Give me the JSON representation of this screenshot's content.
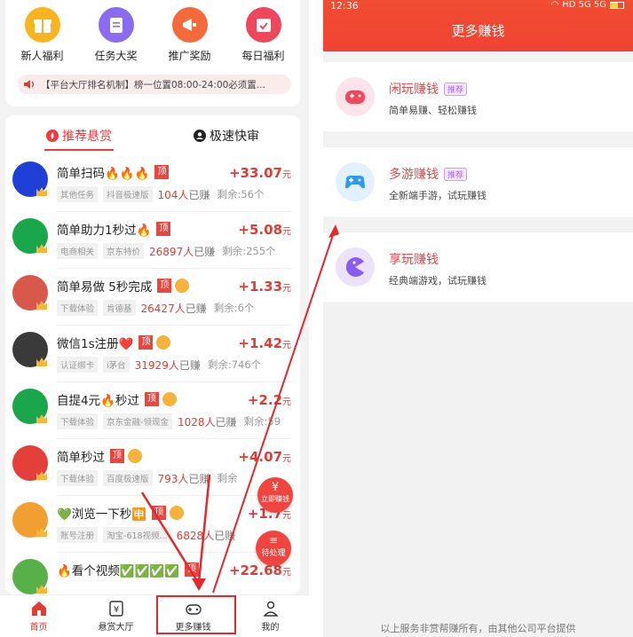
{
  "left": {
    "quick_icons": [
      {
        "label": "新人福利",
        "icon": "gift-icon",
        "color": "#f9b41e"
      },
      {
        "label": "任务大奖",
        "icon": "clipboard-icon",
        "color": "#8b6cf0"
      },
      {
        "label": "推广奖励",
        "icon": "megaphone-icon",
        "color": "#f56a3b"
      },
      {
        "label": "每日福利",
        "icon": "calendar-check-icon",
        "color": "#f0465a"
      }
    ],
    "notice": "【平台大厅排名机制】榜一位置08:00-24:00必须置...",
    "tabs": [
      {
        "label": "推荐悬赏",
        "icon": "flame-icon"
      },
      {
        "label": "极速快审",
        "icon": "user-circle-icon"
      }
    ],
    "tasks": [
      {
        "title": "简单扫码🔥🔥🔥",
        "chips": [
          "其他任务",
          "抖音极速版"
        ],
        "earned": "104人",
        "earned_suffix": "已赚",
        "remain": "剩余:56个",
        "amount": "+33.07",
        "unit": "元",
        "badge": false
      },
      {
        "title": "简单助力1秒过🔥",
        "chips": [
          "电商相关",
          "京东特价"
        ],
        "earned": "26897人",
        "earned_suffix": "已赚",
        "remain": "剩余:255个",
        "amount": "+5.08",
        "unit": "元",
        "badge": false
      },
      {
        "title": "简单易做  5秒完成",
        "chips": [
          "下载体验",
          "肯德基"
        ],
        "earned": "26427人",
        "earned_suffix": "已赚",
        "remain": "剩余:6个",
        "amount": "+1.33",
        "unit": "元",
        "badge": true
      },
      {
        "title": "微信1s注册❤️",
        "chips": [
          "认证绑卡",
          "i茅台"
        ],
        "earned": "31929人",
        "earned_suffix": "已赚",
        "remain": "剩余:746个",
        "amount": "+1.42",
        "unit": "元",
        "badge": true
      },
      {
        "title": "自提4元🔥秒过",
        "chips": [
          "下载体验",
          "京东金融-领现金"
        ],
        "earned": "1028人",
        "earned_suffix": "已赚",
        "remain": "剩余:59",
        "amount": "+2.2",
        "unit": "元",
        "badge": true
      },
      {
        "title": "简单秒过",
        "chips": [
          "下载体验",
          "百度极速版"
        ],
        "earned": "793人",
        "earned_suffix": "已赚",
        "remain": "剩余",
        "amount": "+4.07",
        "unit": "元",
        "badge": true
      },
      {
        "title": "💚浏览一下秒🈸",
        "chips": [
          "账号注册",
          "淘宝-618视频..."
        ],
        "earned": "6828人",
        "earned_suffix": "已赚",
        "remain": "",
        "amount": "+1.7",
        "unit": "元",
        "badge": true
      },
      {
        "title": "🔥看个视频✅✅✅✅",
        "chips": [],
        "earned": "",
        "earned_suffix": "",
        "remain": "",
        "amount": "+22.68",
        "unit": "元",
        "badge": false
      }
    ],
    "floats": {
      "earn_now": "立即赚钱",
      "pending": "待处理"
    },
    "tabbar": [
      {
        "label": "首页",
        "icon": "home-icon"
      },
      {
        "label": "悬赏大厅",
        "icon": "yen-board-icon"
      },
      {
        "label": "更多赚钱",
        "icon": "gamepad-icon"
      },
      {
        "label": "我的",
        "icon": "person-icon"
      }
    ]
  },
  "right": {
    "status_time": "12:36",
    "status_icons": "HD 5G 5G",
    "title": "更多赚钱",
    "games": [
      {
        "name": "闲玩赚钱",
        "tag": "推荐",
        "desc": "简单易赚、轻松赚钱",
        "icon": "gamepad-red-icon",
        "bg": "#fde4ea"
      },
      {
        "name": "多游赚钱",
        "tag": "推荐",
        "desc": "全新端手游，试玩赚钱",
        "icon": "gamepad-blue-icon",
        "bg": "#e2f1fd"
      },
      {
        "name": "享玩赚钱",
        "tag": "",
        "desc": "经典端游戏，试玩赚钱",
        "icon": "pacman-icon",
        "bg": "#ece3fb"
      }
    ],
    "footer": "以上服务非赏帮赚所有，由其他公司平台提供"
  }
}
